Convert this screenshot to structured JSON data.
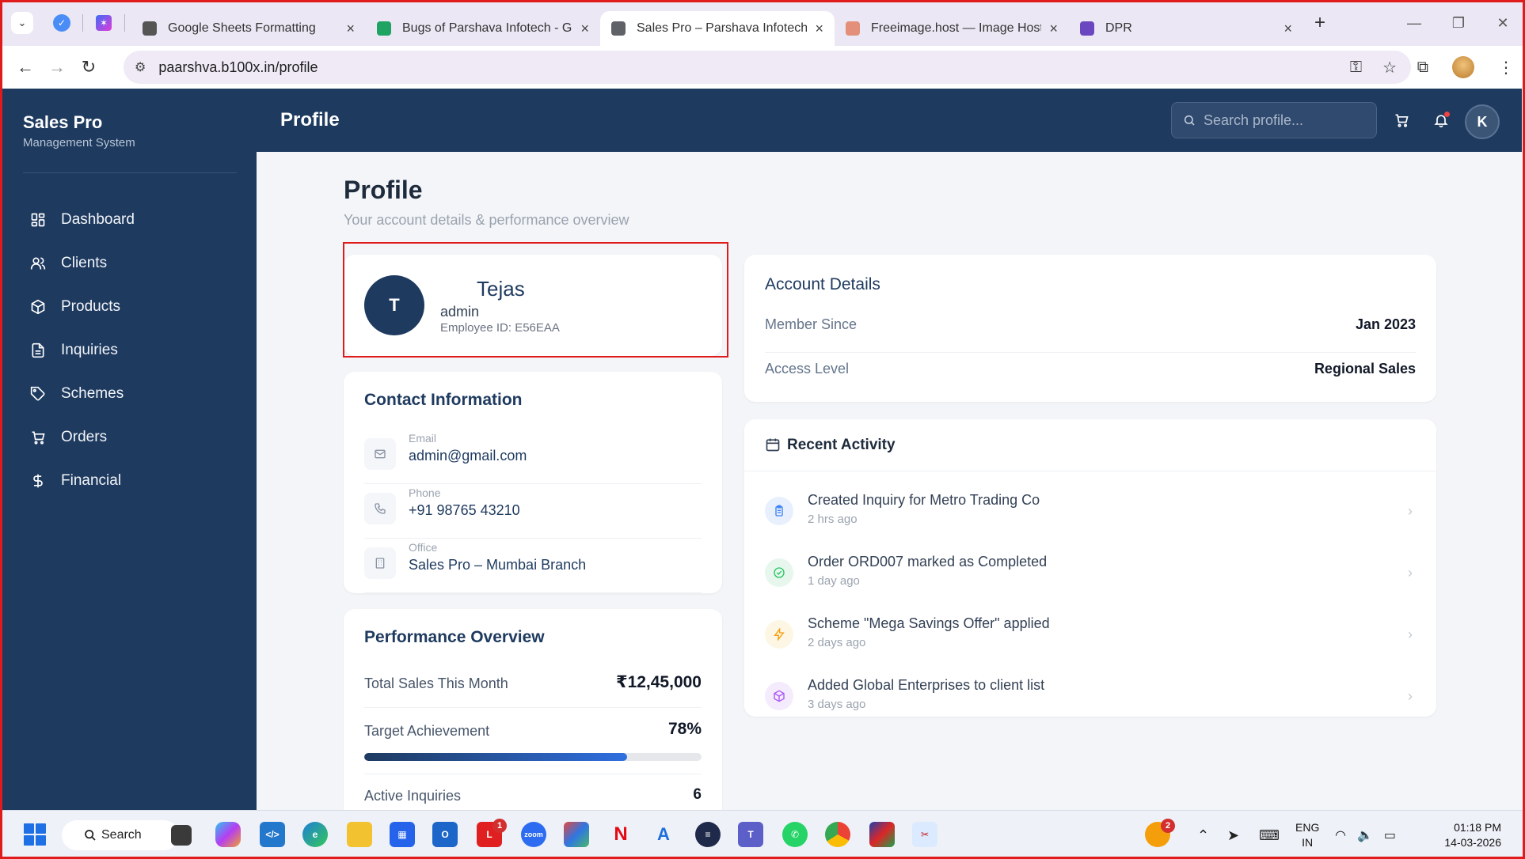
{
  "browser": {
    "tabs": [
      {
        "title": "Google Sheets Formatting",
        "color": "#555555"
      },
      {
        "title": "Bugs of Parshava Infotech - Goo",
        "color": "#1ea362"
      },
      {
        "title": "Sales Pro – Parshava Infotech",
        "color": "#5f6368",
        "active": true
      },
      {
        "title": "Freeimage.host — Image Hosting",
        "color": "#e38f7a"
      },
      {
        "title": "DPR",
        "color": "#6b46c1"
      }
    ],
    "url": "paarshva.b100x.in/profile"
  },
  "app": {
    "brand_title": "Sales Pro",
    "brand_sub": "Management System",
    "page_header": "Profile",
    "search_placeholder": "Search profile...",
    "user_initial": "K",
    "menu": [
      {
        "label": "Dashboard",
        "icon": "dashboard-icon"
      },
      {
        "label": "Clients",
        "icon": "users-icon"
      },
      {
        "label": "Products",
        "icon": "box-icon"
      },
      {
        "label": "Inquiries",
        "icon": "document-icon"
      },
      {
        "label": "Schemes",
        "icon": "tag-icon"
      },
      {
        "label": "Orders",
        "icon": "cart-icon"
      },
      {
        "label": "Financial",
        "icon": "dollar-icon"
      }
    ]
  },
  "profile": {
    "title": "Profile",
    "subtitle": "Your account details & performance overview",
    "initial": "T",
    "name": "Tejas",
    "role": "admin",
    "employee_id": "Employee ID: E56EAA"
  },
  "contact": {
    "title": "Contact Information",
    "items": [
      {
        "label": "Email",
        "value": "admin@gmail.com",
        "icon": "mail-icon"
      },
      {
        "label": "Phone",
        "value": "+91 98765 43210",
        "icon": "phone-icon"
      },
      {
        "label": "Office",
        "value": "Sales Pro – Mumbai Branch",
        "icon": "building-icon"
      }
    ]
  },
  "performance": {
    "title": "Performance Overview",
    "total_sales_label": "Total Sales This Month",
    "total_sales_value": "₹12,45,000",
    "target_label": "Target Achievement",
    "target_value": "78%",
    "target_fraction": 0.78,
    "inquiries_label": "Active Inquiries",
    "inquiries_value": "6"
  },
  "account": {
    "title": "Account Details",
    "rows": [
      {
        "label": "Member Since",
        "value": "Jan 2023"
      },
      {
        "label": "Access Level",
        "value": "Regional Sales"
      }
    ]
  },
  "activity": {
    "title": "Recent Activity",
    "items": [
      {
        "text": "Created Inquiry for Metro Trading Co",
        "time": "2 hrs ago",
        "icon": "clipboard-icon",
        "color": "#3b82f6",
        "bg": "#e8f0fe"
      },
      {
        "text": "Order ORD007 marked as Completed",
        "time": "1 day ago",
        "icon": "check-circle-icon",
        "color": "#22c55e",
        "bg": "#e7f7ee"
      },
      {
        "text": "Scheme \"Mega Savings Offer\" applied",
        "time": "2 days ago",
        "icon": "lightning-icon",
        "color": "#f59e0b",
        "bg": "#fef6e4"
      },
      {
        "text": "Added Global Enterprises to client list",
        "time": "3 days ago",
        "icon": "package-icon",
        "color": "#a855f7",
        "bg": "#f4ebfd"
      }
    ]
  },
  "taskbar": {
    "search_label": "Search",
    "lang_top": "ENG",
    "lang_bottom": "IN",
    "time": "01:18 PM",
    "date": "14-03-2026",
    "outlook_badge": "1",
    "tray_badge": "2"
  }
}
